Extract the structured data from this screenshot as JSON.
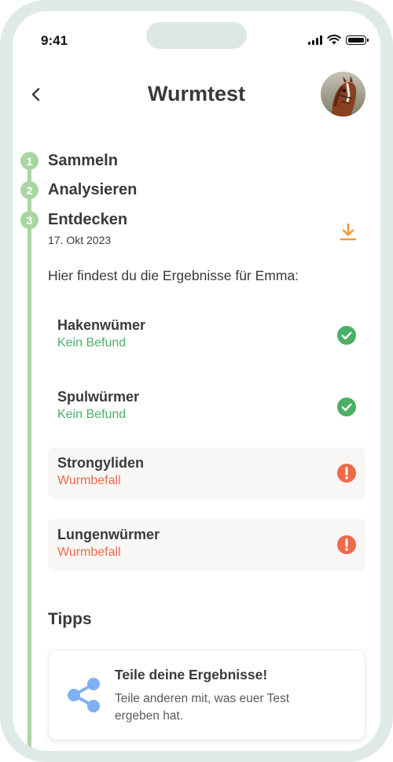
{
  "status_bar": {
    "time": "9:41"
  },
  "header": {
    "title": "Wurmtest"
  },
  "steps": [
    {
      "number": "1",
      "label": "Sammeln"
    },
    {
      "number": "2",
      "label": "Analysieren"
    },
    {
      "number": "3",
      "label": "Entdecken",
      "date": "17. Okt 2023"
    }
  ],
  "intro_text": "Hier findest du die Ergebnisse für Emma:",
  "results": [
    {
      "name": "Hakenwümer",
      "status": "Kein Befund",
      "state": "ok",
      "icon": "check-circle-icon"
    },
    {
      "name": "Spulwürmer",
      "status": "Kein Befund",
      "state": "ok",
      "icon": "check-circle-icon"
    },
    {
      "name": "Strongyliden",
      "status": "Wurmbefall",
      "state": "warn",
      "icon": "alert-circle-icon"
    },
    {
      "name": "Lungenwürmer",
      "status": "Wurmbefall",
      "state": "warn",
      "icon": "alert-circle-icon"
    }
  ],
  "tips": {
    "title": "Tipps",
    "card": {
      "heading": "Teile deine Ergebnisse!",
      "text": "Teile anderen mit, was euer Test ergeben hat.",
      "icon": "share-icon"
    }
  },
  "colors": {
    "timeline": "#a9d6a0",
    "ok": "#4caf66",
    "warn": "#ee6a4a",
    "download": "#f39a3d",
    "share": "#7fb0f2"
  }
}
